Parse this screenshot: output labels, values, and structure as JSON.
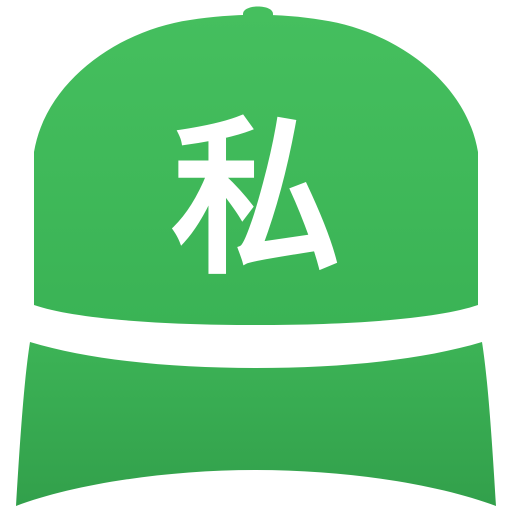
{
  "emblem": {
    "character": "私"
  },
  "icon": {
    "name": "baseball-cap-icon"
  },
  "colors": {
    "crown_top": "#45bf5e",
    "crown_bottom": "#35aa4f",
    "brim_top": "#3cb356",
    "brim_bottom": "#2f9a47",
    "band": "#ffffff",
    "emblem": "#ffffff"
  }
}
